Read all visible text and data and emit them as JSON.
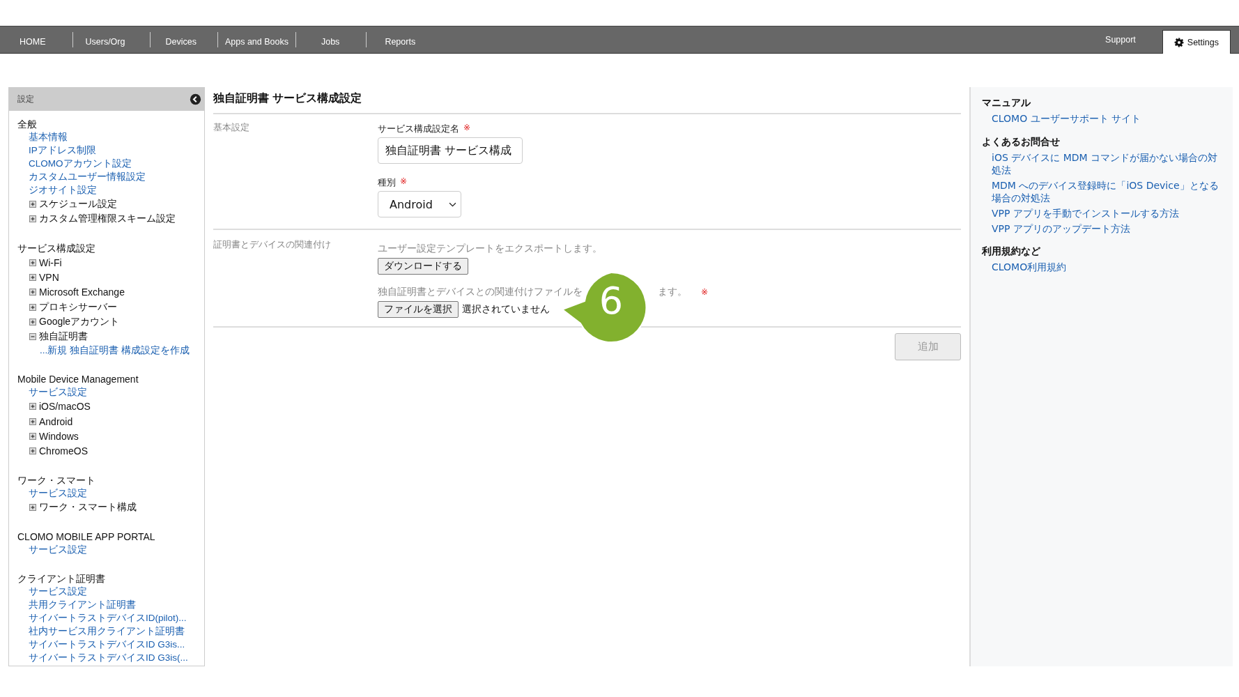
{
  "nav": {
    "tabs": [
      {
        "label": "HOME",
        "selected": false
      },
      {
        "label": "Users/Org",
        "selected": false
      },
      {
        "label": "Devices",
        "selected": false
      },
      {
        "label": "Apps and Books",
        "selected": false
      },
      {
        "label": "Jobs",
        "selected": false
      },
      {
        "label": "Reports",
        "selected": false
      }
    ],
    "right_tabs": [
      {
        "label": "Support",
        "selected": false,
        "icon": false
      },
      {
        "label": "Settings",
        "selected": true,
        "icon": true
      }
    ]
  },
  "sidebar": {
    "title": "設定",
    "sections": [
      {
        "title": "全般",
        "items": [
          {
            "kind": "link",
            "label": "基本情報"
          },
          {
            "kind": "link",
            "label": "IPアドレス制限"
          },
          {
            "kind": "link",
            "label": "CLOMOアカウント設定"
          },
          {
            "kind": "link",
            "label": "カスタムユーザー情報設定"
          },
          {
            "kind": "link",
            "label": "ジオサイト設定"
          },
          {
            "kind": "tree",
            "label": "スケジュール設定",
            "expanded": false
          },
          {
            "kind": "tree",
            "label": "カスタム管理権限スキーム設定",
            "expanded": false
          }
        ]
      },
      {
        "title": "サービス構成設定",
        "items": [
          {
            "kind": "tree",
            "label": "Wi-Fi",
            "expanded": false
          },
          {
            "kind": "tree",
            "label": "VPN",
            "expanded": false
          },
          {
            "kind": "tree",
            "label": "Microsoft Exchange",
            "expanded": false
          },
          {
            "kind": "tree",
            "label": "プロキシサーバー",
            "expanded": false
          },
          {
            "kind": "tree",
            "label": "Googleアカウント",
            "expanded": false
          },
          {
            "kind": "tree",
            "label": "独自証明書",
            "expanded": true,
            "children": [
              {
                "kind": "link",
                "label": "...新規 独自証明書 構成設定を作成"
              }
            ]
          }
        ]
      },
      {
        "title": "Mobile Device Management",
        "items": [
          {
            "kind": "link",
            "label": "サービス設定"
          },
          {
            "kind": "tree",
            "label": "iOS/macOS",
            "expanded": false
          },
          {
            "kind": "tree",
            "label": "Android",
            "expanded": false
          },
          {
            "kind": "tree",
            "label": "Windows",
            "expanded": false
          },
          {
            "kind": "tree",
            "label": "ChromeOS",
            "expanded": false
          }
        ]
      },
      {
        "title": "ワーク・スマート",
        "items": [
          {
            "kind": "link",
            "label": "サービス設定"
          },
          {
            "kind": "tree",
            "label": "ワーク・スマート構成",
            "expanded": false
          }
        ]
      },
      {
        "title": "CLOMO MOBILE APP PORTAL",
        "items": [
          {
            "kind": "link",
            "label": "サービス設定"
          }
        ]
      },
      {
        "title": "クライアント証明書",
        "items": [
          {
            "kind": "link",
            "label": "サービス設定"
          },
          {
            "kind": "link",
            "label": "共用クライアント証明書"
          },
          {
            "kind": "link",
            "label": "サイバートラストデバイスID(pilot)..."
          },
          {
            "kind": "link",
            "label": "社内サービス用クライアント証明書"
          },
          {
            "kind": "link",
            "label": "サイバートラストデバイスID G3is..."
          },
          {
            "kind": "link",
            "label": "サイバートラストデバイスID G3is(..."
          }
        ]
      }
    ]
  },
  "main": {
    "title": "独自証明書 サービス構成設定",
    "basic": {
      "label": "基本設定",
      "name_field": {
        "label": "サービス構成設定名",
        "required_mark": "※",
        "value": "独自証明書 サービス構成"
      },
      "type_field": {
        "label": "種別",
        "required_mark": "※",
        "value": "Android"
      }
    },
    "association": {
      "label": "証明書とデバイスの関連付け",
      "export_text": "ユーザー設定テンプレートをエクスポートします。",
      "download_button": "ダウンロードする",
      "import_text_start": "独自証明書とデバイスとの関連付けファイルを",
      "import_text_end": "ます。",
      "import_required_mark": "※",
      "file_button": "ファイルを選択",
      "file_status": "選択されていません"
    },
    "add_button": {
      "label": "追加",
      "disabled": true
    }
  },
  "callout": {
    "number": "6"
  },
  "help": {
    "sections": [
      {
        "title": "マニュアル",
        "links": [
          "CLOMO ユーザーサポート サイト"
        ]
      },
      {
        "title": "よくあるお問合せ",
        "links": [
          "iOS デバイスに MDM コマンドが届かない場合の対処法",
          "MDM へのデバイス登録時に「iOS Device」となる場合の対処法",
          "VPP アプリを手動でインストールする方法",
          "VPP アプリのアップデート方法"
        ]
      },
      {
        "title": "利用規約など",
        "links": [
          "CLOMO利用規約"
        ]
      }
    ]
  }
}
